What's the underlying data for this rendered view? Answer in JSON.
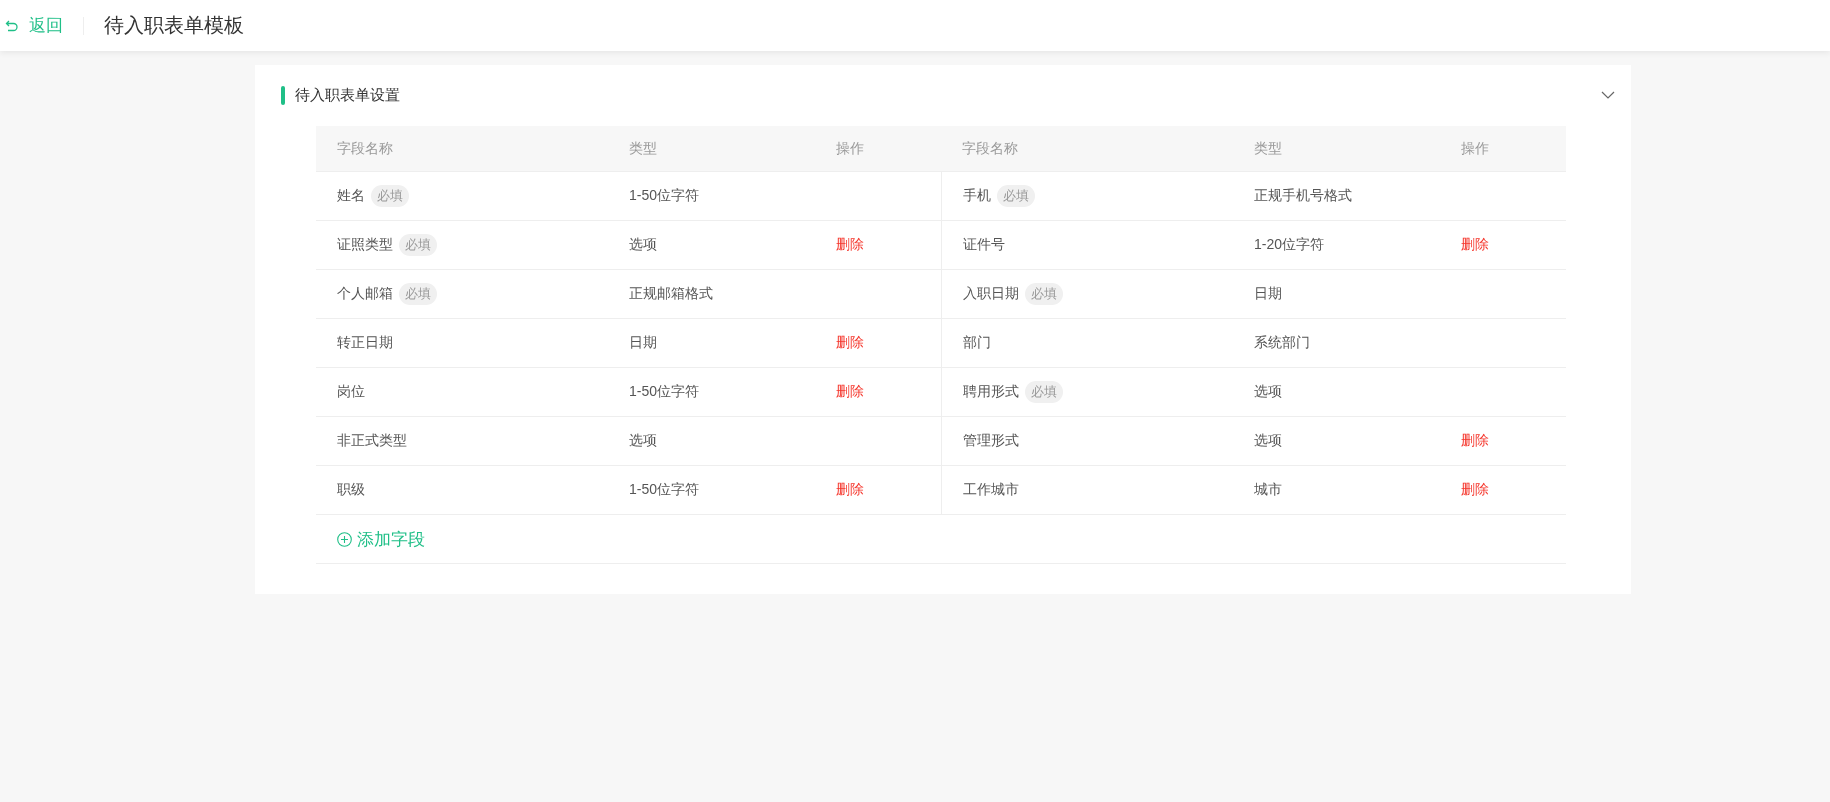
{
  "header": {
    "back": "返回",
    "title": "待入职表单模板"
  },
  "section": {
    "title": "待入职表单设置",
    "expanded": true
  },
  "table": {
    "columns": [
      "字段名称",
      "类型",
      "操作",
      "字段名称",
      "类型",
      "操作"
    ],
    "fields": [
      {
        "name": "姓名",
        "tag": "必填",
        "type": "1-50位字符"
      },
      {
        "name": "手机",
        "tag": "必填",
        "type": "正规手机号格式"
      },
      {
        "name": "证照类型",
        "tag": "必填",
        "type": "选项",
        "action": "删除"
      },
      {
        "name": "证件号",
        "type": "1-20位字符",
        "action": "删除"
      },
      {
        "name": "个人邮箱",
        "tag": "必填",
        "type": "正规邮箱格式"
      },
      {
        "name": "入职日期",
        "tag": "必填",
        "type": "日期"
      },
      {
        "name": "转正日期",
        "type": "日期",
        "action": "删除"
      },
      {
        "name": "部门",
        "type": "系统部门"
      },
      {
        "name": "岗位",
        "type": "1-50位字符",
        "action": "删除"
      },
      {
        "name": "聘用形式",
        "tag": "必填",
        "type": "选项"
      },
      {
        "name": "非正式类型",
        "type": "选项"
      },
      {
        "name": "管理形式",
        "type": "选项",
        "action": "删除"
      },
      {
        "name": "职级",
        "type": "1-50位字符",
        "action": "删除"
      },
      {
        "name": "工作城市",
        "type": "城市",
        "action": "删除"
      }
    ],
    "add": "添加字段"
  }
}
